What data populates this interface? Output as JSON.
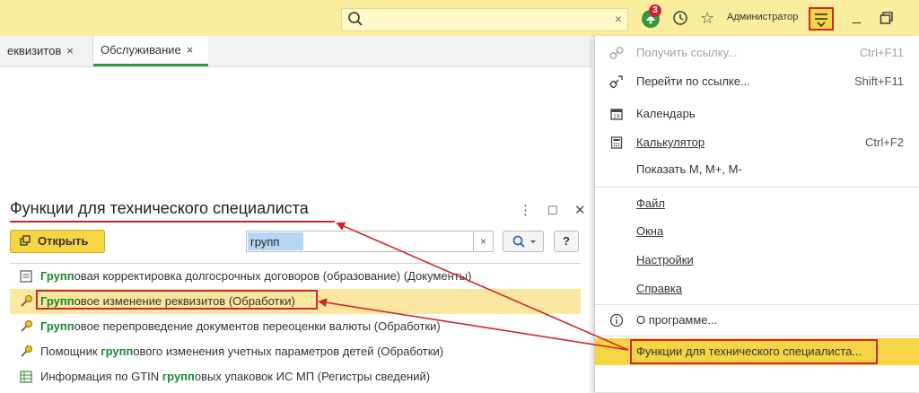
{
  "topbar": {
    "search_placeholder": "",
    "notifications_count": "3",
    "user_name": "Администратор"
  },
  "tabs": [
    {
      "label": "еквизитов"
    },
    {
      "label": "Обслуживание"
    }
  ],
  "form": {
    "title": "Функции для технического специалиста",
    "open_button": "Открыть",
    "search_value": "групп",
    "help_label": "?"
  },
  "list": [
    {
      "prefix": "Групп",
      "rest": "овая корректировка долгосрочных договоров (образование) (Документы)",
      "icon": "document-icon"
    },
    {
      "prefix": "Групп",
      "rest": "овое изменение реквизитов (Обработки)",
      "icon": "processing-icon",
      "selected": true
    },
    {
      "prefix": "Групп",
      "rest": "овое перепроведение документов переоценки валюты (Обработки)",
      "icon": "processing-icon"
    },
    {
      "pre": "Помощник ",
      "prefix": "групп",
      "rest": "ового изменения учетных параметров детей (Обработки)",
      "icon": "processing-icon"
    },
    {
      "pre": "Информация по GTIN ",
      "prefix": "групп",
      "rest": "овых упаковок ИС МП (Регистры сведений)",
      "icon": "register-icon"
    }
  ],
  "menu": {
    "get_link": {
      "label": "Получить ссылку...",
      "shortcut": "Ctrl+F11"
    },
    "goto_link": {
      "label": "Перейти по ссылке...",
      "shortcut": "Shift+F11"
    },
    "calendar": {
      "label": "Календарь"
    },
    "calculator": {
      "label": "Калькулятор",
      "shortcut": "Ctrl+F2"
    },
    "show_m": {
      "label": "Показать М, М+, М-"
    },
    "file": {
      "label": "Файл"
    },
    "windows": {
      "label": "Окна"
    },
    "settings": {
      "label": "Настройки"
    },
    "help": {
      "label": "Справка"
    },
    "about": {
      "label": "О программе..."
    },
    "tech_functions": {
      "label": "Функции для технического специалиста..."
    }
  },
  "colors": {
    "accent_yellow": "#f6d544",
    "annotation_red": "#d1262c",
    "match_green": "#1a8a2e"
  }
}
